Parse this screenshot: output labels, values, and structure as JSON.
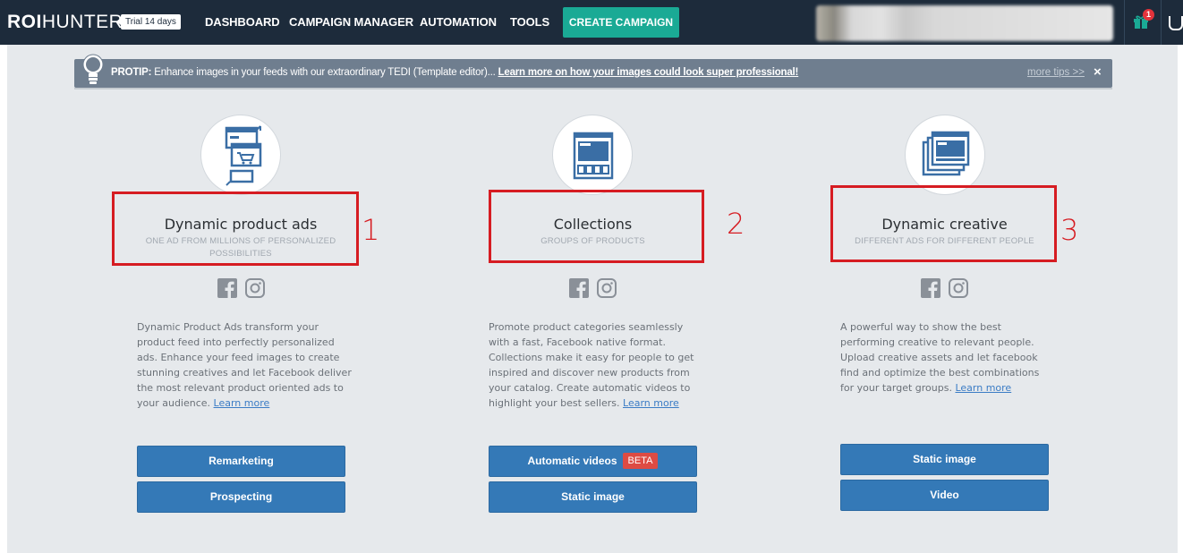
{
  "header": {
    "logo_bold": "ROI",
    "logo_light": "HUNTER",
    "trial_badge": "Trial 14 days",
    "nav": [
      "DASHBOARD",
      "CAMPAIGN MANAGER",
      "AUTOMATION",
      "TOOLS"
    ],
    "create_campaign": "CREATE CAMPAIGN",
    "notification_count": "1"
  },
  "protip": {
    "label": "PROTIP:",
    "text": " Enhance images in your feeds with our extraordinary TEDI (Template editor)... ",
    "link": "Learn more on how your images could look super professional!",
    "more_tips": "more tips >>",
    "close": "×"
  },
  "columns": [
    {
      "title": "Dynamic product ads",
      "subtitle": "ONE AD FROM MILLIONS OF PERSONALIZED POSSIBILITIES",
      "annotation": "1",
      "description": "Dynamic Product Ads transform your product feed into perfectly personalized ads. Enhance your feed images to create stunning creatives and let Facebook deliver the most relevant product oriented ads to your audience. ",
      "learn_more": "Learn more",
      "buttons": [
        "Remarketing",
        "Prospecting"
      ]
    },
    {
      "title": "Collections",
      "subtitle": "GROUPS OF PRODUCTS",
      "annotation": "2",
      "description": "Promote product categories seamlessly with a fast, Facebook native format. Collections make it easy for people to get inspired and discover new products from your catalog. Create automatic videos to highlight your best sellers. ",
      "learn_more": "Learn more",
      "buttons": [
        "Automatic videos",
        "Static image"
      ],
      "beta_badge": "BETA"
    },
    {
      "title": "Dynamic creative",
      "subtitle": "DIFFERENT ADS FOR DIFFERENT PEOPLE",
      "annotation": "3",
      "description": "A powerful way to show the best performing creative to relevant people. Upload creative assets and let facebook find and optimize the best combinations for your target groups. ",
      "learn_more": "Learn more",
      "buttons": [
        "Static image",
        "Video"
      ]
    }
  ],
  "colors": {
    "nav_bg": "#1d2b3b",
    "create_btn": "#1aaa95",
    "content_bg": "#e6e9ec",
    "protip_bg": "#6f7e8f",
    "button_blue": "#3479b7",
    "annotation_red": "#d61c22",
    "icon_blue": "#3a6ea5"
  }
}
